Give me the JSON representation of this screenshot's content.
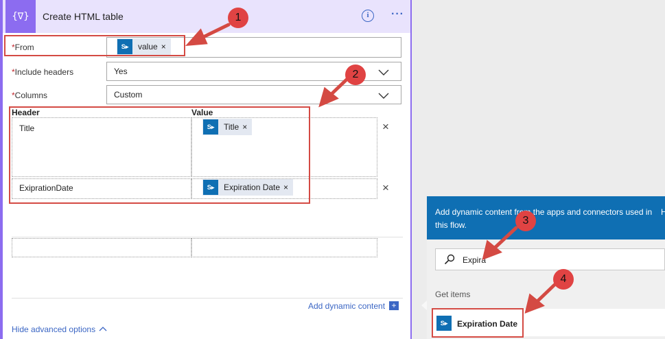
{
  "action": {
    "icon_glyph": "{∇}",
    "title": "Create HTML table",
    "info_glyph": "i",
    "more_glyph": "···"
  },
  "form": {
    "from": {
      "label": "From",
      "required_mark": "*",
      "token": "value"
    },
    "include_headers": {
      "label": "Include headers",
      "required_mark": "*",
      "value": "Yes"
    },
    "columns": {
      "label": "Columns",
      "required_mark": "*",
      "value": "Custom"
    }
  },
  "table": {
    "header_col": "Header",
    "value_col": "Value",
    "rows": [
      {
        "header": "Title",
        "token": "Title"
      },
      {
        "header": "ExiprationDate",
        "token": "Expiration Date"
      }
    ]
  },
  "token_glyph": "S▸",
  "close_glyph": "×",
  "add_dynamic_label": "Add dynamic content",
  "add_glyph": "+",
  "hide_advanced_label": "Hide advanced options",
  "chevron_up_glyph": "^",
  "panel": {
    "description": "Add dynamic content from the apps and connectors used in this flow.",
    "cut_text": "H",
    "search_value": "Expira",
    "group_label": "Get items",
    "item_label": "Expiration Date"
  },
  "annotations": [
    "1",
    "2",
    "3",
    "4"
  ],
  "colors": {
    "accent": "#8c6cf0",
    "sharepoint_blue": "#0f6fb3",
    "annotation_red": "#d44a43"
  }
}
